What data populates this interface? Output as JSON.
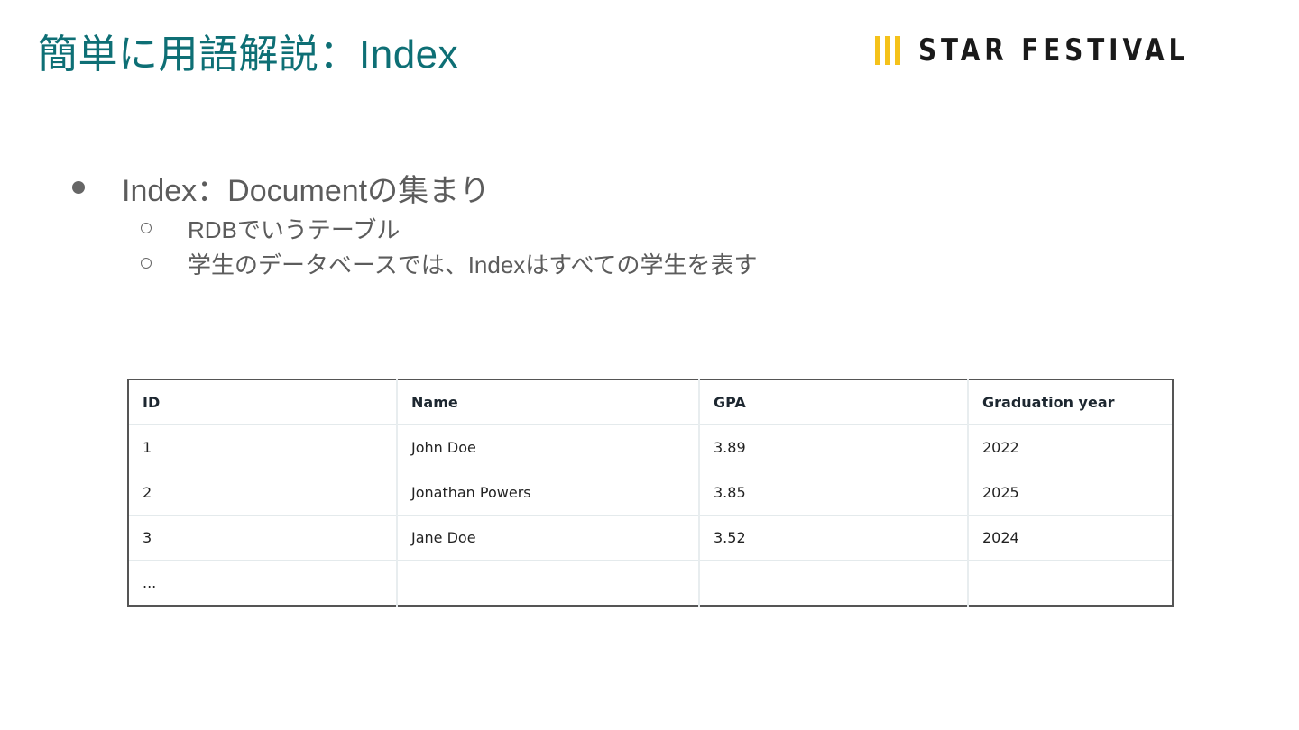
{
  "slide": {
    "title": "簡単に用語解説：Index",
    "logo_text": "STAR FESTIVAL",
    "colors": {
      "title": "#0e6f75",
      "logo_mark": "#f5c21a",
      "rule": "#8fc4c7"
    }
  },
  "bullets": {
    "main": "Index：Documentの集まり",
    "sub1": "RDBでいうテーブル",
    "sub2": "学生のデータベースでは、Indexはすべての学生を表す"
  },
  "table": {
    "headers": [
      "ID",
      "Name",
      "GPA",
      "Graduation year"
    ],
    "rows": [
      [
        "1",
        "John Doe",
        "3.89",
        "2022"
      ],
      [
        "2",
        "Jonathan Powers",
        "3.85",
        "2025"
      ],
      [
        "3",
        "Jane Doe",
        "3.52",
        "2024"
      ],
      [
        "...",
        "",
        "",
        ""
      ]
    ]
  }
}
